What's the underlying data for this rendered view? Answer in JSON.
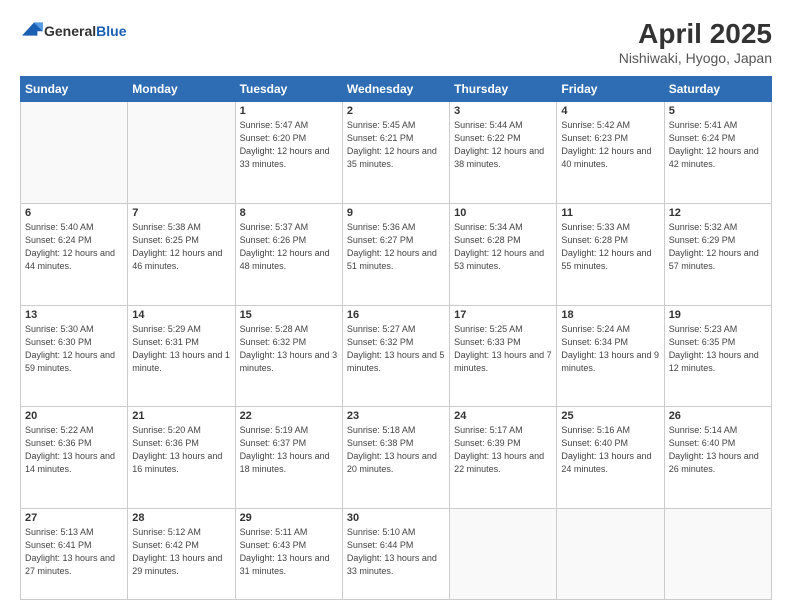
{
  "header": {
    "logo_general": "General",
    "logo_blue": "Blue",
    "month_year": "April 2025",
    "location": "Nishiwaki, Hyogo, Japan"
  },
  "weekdays": [
    "Sunday",
    "Monday",
    "Tuesday",
    "Wednesday",
    "Thursday",
    "Friday",
    "Saturday"
  ],
  "rows": [
    [
      {
        "day": "",
        "sunrise": "",
        "sunset": "",
        "daylight": ""
      },
      {
        "day": "",
        "sunrise": "",
        "sunset": "",
        "daylight": ""
      },
      {
        "day": "1",
        "sunrise": "Sunrise: 5:47 AM",
        "sunset": "Sunset: 6:20 PM",
        "daylight": "Daylight: 12 hours and 33 minutes."
      },
      {
        "day": "2",
        "sunrise": "Sunrise: 5:45 AM",
        "sunset": "Sunset: 6:21 PM",
        "daylight": "Daylight: 12 hours and 35 minutes."
      },
      {
        "day": "3",
        "sunrise": "Sunrise: 5:44 AM",
        "sunset": "Sunset: 6:22 PM",
        "daylight": "Daylight: 12 hours and 38 minutes."
      },
      {
        "day": "4",
        "sunrise": "Sunrise: 5:42 AM",
        "sunset": "Sunset: 6:23 PM",
        "daylight": "Daylight: 12 hours and 40 minutes."
      },
      {
        "day": "5",
        "sunrise": "Sunrise: 5:41 AM",
        "sunset": "Sunset: 6:24 PM",
        "daylight": "Daylight: 12 hours and 42 minutes."
      }
    ],
    [
      {
        "day": "6",
        "sunrise": "Sunrise: 5:40 AM",
        "sunset": "Sunset: 6:24 PM",
        "daylight": "Daylight: 12 hours and 44 minutes."
      },
      {
        "day": "7",
        "sunrise": "Sunrise: 5:38 AM",
        "sunset": "Sunset: 6:25 PM",
        "daylight": "Daylight: 12 hours and 46 minutes."
      },
      {
        "day": "8",
        "sunrise": "Sunrise: 5:37 AM",
        "sunset": "Sunset: 6:26 PM",
        "daylight": "Daylight: 12 hours and 48 minutes."
      },
      {
        "day": "9",
        "sunrise": "Sunrise: 5:36 AM",
        "sunset": "Sunset: 6:27 PM",
        "daylight": "Daylight: 12 hours and 51 minutes."
      },
      {
        "day": "10",
        "sunrise": "Sunrise: 5:34 AM",
        "sunset": "Sunset: 6:28 PM",
        "daylight": "Daylight: 12 hours and 53 minutes."
      },
      {
        "day": "11",
        "sunrise": "Sunrise: 5:33 AM",
        "sunset": "Sunset: 6:28 PM",
        "daylight": "Daylight: 12 hours and 55 minutes."
      },
      {
        "day": "12",
        "sunrise": "Sunrise: 5:32 AM",
        "sunset": "Sunset: 6:29 PM",
        "daylight": "Daylight: 12 hours and 57 minutes."
      }
    ],
    [
      {
        "day": "13",
        "sunrise": "Sunrise: 5:30 AM",
        "sunset": "Sunset: 6:30 PM",
        "daylight": "Daylight: 12 hours and 59 minutes."
      },
      {
        "day": "14",
        "sunrise": "Sunrise: 5:29 AM",
        "sunset": "Sunset: 6:31 PM",
        "daylight": "Daylight: 13 hours and 1 minute."
      },
      {
        "day": "15",
        "sunrise": "Sunrise: 5:28 AM",
        "sunset": "Sunset: 6:32 PM",
        "daylight": "Daylight: 13 hours and 3 minutes."
      },
      {
        "day": "16",
        "sunrise": "Sunrise: 5:27 AM",
        "sunset": "Sunset: 6:32 PM",
        "daylight": "Daylight: 13 hours and 5 minutes."
      },
      {
        "day": "17",
        "sunrise": "Sunrise: 5:25 AM",
        "sunset": "Sunset: 6:33 PM",
        "daylight": "Daylight: 13 hours and 7 minutes."
      },
      {
        "day": "18",
        "sunrise": "Sunrise: 5:24 AM",
        "sunset": "Sunset: 6:34 PM",
        "daylight": "Daylight: 13 hours and 9 minutes."
      },
      {
        "day": "19",
        "sunrise": "Sunrise: 5:23 AM",
        "sunset": "Sunset: 6:35 PM",
        "daylight": "Daylight: 13 hours and 12 minutes."
      }
    ],
    [
      {
        "day": "20",
        "sunrise": "Sunrise: 5:22 AM",
        "sunset": "Sunset: 6:36 PM",
        "daylight": "Daylight: 13 hours and 14 minutes."
      },
      {
        "day": "21",
        "sunrise": "Sunrise: 5:20 AM",
        "sunset": "Sunset: 6:36 PM",
        "daylight": "Daylight: 13 hours and 16 minutes."
      },
      {
        "day": "22",
        "sunrise": "Sunrise: 5:19 AM",
        "sunset": "Sunset: 6:37 PM",
        "daylight": "Daylight: 13 hours and 18 minutes."
      },
      {
        "day": "23",
        "sunrise": "Sunrise: 5:18 AM",
        "sunset": "Sunset: 6:38 PM",
        "daylight": "Daylight: 13 hours and 20 minutes."
      },
      {
        "day": "24",
        "sunrise": "Sunrise: 5:17 AM",
        "sunset": "Sunset: 6:39 PM",
        "daylight": "Daylight: 13 hours and 22 minutes."
      },
      {
        "day": "25",
        "sunrise": "Sunrise: 5:16 AM",
        "sunset": "Sunset: 6:40 PM",
        "daylight": "Daylight: 13 hours and 24 minutes."
      },
      {
        "day": "26",
        "sunrise": "Sunrise: 5:14 AM",
        "sunset": "Sunset: 6:40 PM",
        "daylight": "Daylight: 13 hours and 26 minutes."
      }
    ],
    [
      {
        "day": "27",
        "sunrise": "Sunrise: 5:13 AM",
        "sunset": "Sunset: 6:41 PM",
        "daylight": "Daylight: 13 hours and 27 minutes."
      },
      {
        "day": "28",
        "sunrise": "Sunrise: 5:12 AM",
        "sunset": "Sunset: 6:42 PM",
        "daylight": "Daylight: 13 hours and 29 minutes."
      },
      {
        "day": "29",
        "sunrise": "Sunrise: 5:11 AM",
        "sunset": "Sunset: 6:43 PM",
        "daylight": "Daylight: 13 hours and 31 minutes."
      },
      {
        "day": "30",
        "sunrise": "Sunrise: 5:10 AM",
        "sunset": "Sunset: 6:44 PM",
        "daylight": "Daylight: 13 hours and 33 minutes."
      },
      {
        "day": "",
        "sunrise": "",
        "sunset": "",
        "daylight": ""
      },
      {
        "day": "",
        "sunrise": "",
        "sunset": "",
        "daylight": ""
      },
      {
        "day": "",
        "sunrise": "",
        "sunset": "",
        "daylight": ""
      }
    ]
  ]
}
